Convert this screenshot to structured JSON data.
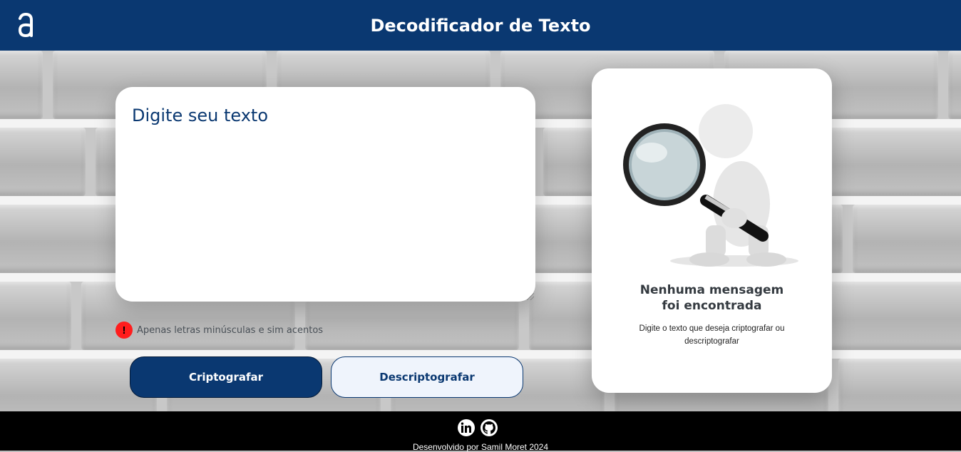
{
  "header": {
    "title": "Decodificador de Texto",
    "logo_icon": "alura-a-logo-icon"
  },
  "input": {
    "placeholder": "Digite seu texto",
    "value": ""
  },
  "hint": {
    "icon": "exclamation-icon",
    "text": "Apenas letras minúsculas e sim acentos"
  },
  "buttons": {
    "encrypt_label": "Criptografar",
    "decrypt_label": "Descriptografar"
  },
  "output": {
    "illustration": "magnifying-glass-figure-icon",
    "title_line1": "Nenhuma mensagem",
    "title_line2": "foi encontrada",
    "description": "Digite o texto que deseja criptografar ou descriptografar"
  },
  "footer": {
    "icons": [
      "linkedin-icon",
      "github-icon"
    ],
    "credit": "Desenvolvido por Samil Moret 2024"
  },
  "colors": {
    "primary": "#0a3871",
    "secondary_bg": "#eff4fc",
    "alert": "#ff1d1d",
    "footer_bg": "#000000"
  }
}
